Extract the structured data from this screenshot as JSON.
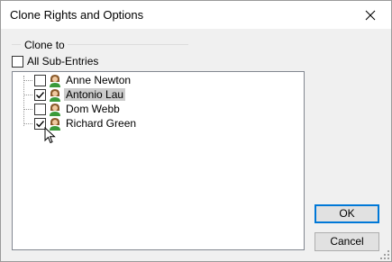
{
  "window": {
    "title": "Clone Rights and Options"
  },
  "group": {
    "label": "Clone to"
  },
  "all_sub_entries": {
    "label": "All Sub-Entries",
    "checked": false
  },
  "tree": {
    "items": [
      {
        "label": "Anne Newton",
        "checked": false,
        "selected": false,
        "icon": "user-icon"
      },
      {
        "label": "Antonio Lau",
        "checked": true,
        "selected": true,
        "icon": "user-icon"
      },
      {
        "label": "Dom Webb",
        "checked": false,
        "selected": false,
        "icon": "user-icon"
      },
      {
        "label": "Richard Green",
        "checked": true,
        "selected": false,
        "icon": "user-icon"
      }
    ]
  },
  "buttons": {
    "ok": "OK",
    "cancel": "Cancel"
  }
}
